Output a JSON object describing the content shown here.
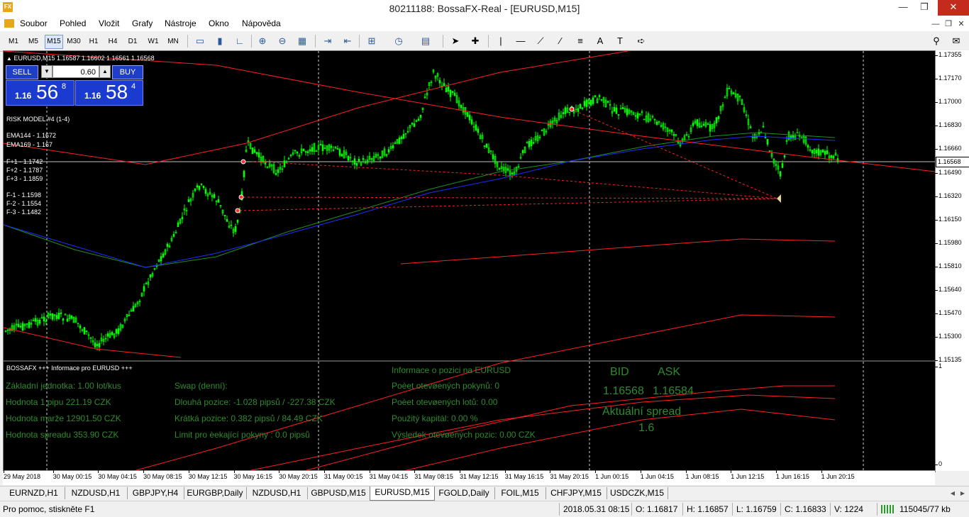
{
  "window": {
    "title": "80211188: BossaFX-Real - [EURUSD,M15]",
    "app_icon_text": "FX"
  },
  "menu": [
    "Soubor",
    "Pohled",
    "Vložit",
    "Grafy",
    "Nástroje",
    "Okno",
    "Nápověda"
  ],
  "toolbar": {
    "timeframes": [
      "M1",
      "M5",
      "M15",
      "M30",
      "H1",
      "H4",
      "D1",
      "W1",
      "MN"
    ],
    "active_timeframe": "M15"
  },
  "chart": {
    "header": "EURUSD,M15  1.16587 1.16602 1.16561 1.16568",
    "current_price": "1.16568",
    "price_ticks": [
      "1.17355",
      "1.17170",
      "1.17000",
      "1.16830",
      "1.16660",
      "1.16490",
      "1.16320",
      "1.16150",
      "1.15980",
      "1.15810",
      "1.15640",
      "1.15470",
      "1.15300",
      "1.15135"
    ],
    "time_ticks": [
      "29 May 2018",
      "30 May 00:15",
      "30 May 04:15",
      "30 May 08:15",
      "30 May 12:15",
      "30 May 16:15",
      "30 May 20:15",
      "31 May 00:15",
      "31 May 04:15",
      "31 May 08:15",
      "31 May 12:15",
      "31 May 16:15",
      "31 May 20:15",
      "1 Jun 00:15",
      "1 Jun 04:15",
      "1 Jun 08:15",
      "1 Jun 12:15",
      "1 Jun 16:15",
      "1 Jun 20:15"
    ],
    "indicator_scale_top": "1",
    "indicator_scale_bottom": "0",
    "risk_model": "RISK MODEL #4 (1-4)",
    "ema_labels": [
      "EMA144 - 1.1672",
      "EMA169 - 1.167"
    ],
    "fib_plus": [
      "F+1 - 1.1742",
      "F+2 - 1.1787",
      "F+3 - 1.1859"
    ],
    "fib_minus": [
      "F-1 - 1.1598",
      "F-2 - 1.1554",
      "F-3 - 1.1482"
    ],
    "colors": {
      "candles": "#00ff00",
      "ema144": "#1e2eff",
      "ema169": "#1f8f1f",
      "bands": "#ff2020",
      "background": "#000000"
    }
  },
  "one_click": {
    "sell_label": "SELL",
    "buy_label": "BUY",
    "lot": "0.60",
    "bid_small": "1.16",
    "bid_big": "56",
    "bid_sup": "8",
    "ask_small": "1.16",
    "ask_big": "58",
    "ask_sup": "4"
  },
  "info_panel": {
    "header": "BOSSAFX +++ Informace pro EURUSD +++",
    "col1": [
      "Základní jednotka: 1.00  lot/kus",
      "Hodnota 1 pipu 221.19 CZK",
      "Hodnota marže 12901.50 CZK",
      "Hodnota spreadu 353.90 CZK"
    ],
    "col2": [
      "Swap (denní):",
      "Dlouhá pozice:   -1.028 pipsů /  -227.38 CZK",
      "Krátká pozice:  0.382 pipsů /  84.49 CZK",
      "Limit pro èekající pokyny : 0.0  pipsů"
    ],
    "col3": [
      "Informace o pozici na EURUSD",
      "Poèet otevøených pokynů: 0",
      "Poèet otevøených lotů: 0.00",
      "Použitý kapitál: 0.00 %",
      "Výsledek otevøených pozic: 0.00 CZK"
    ],
    "bid_label": "BID",
    "ask_label": "ASK",
    "bid_value": "1.16568",
    "ask_value": "1.16584",
    "spread_label": "Aktuální spread",
    "spread_value": "1.6"
  },
  "tabs": [
    "EURNZD,H1",
    "NZDUSD,H1",
    "GBPJPY,H4",
    "EURGBP,Daily",
    "NZDUSD,H1",
    "GBPUSD,M15",
    "EURUSD,M15",
    "FGOLD,Daily",
    "FOIL,M15",
    "CHFJPY,M15",
    "USDCZK,M15"
  ],
  "active_tab": "EURUSD,M15",
  "status": {
    "help": "Pro pomoc, stiskněte F1",
    "datetime": "2018.05.31 08:15",
    "open": "O: 1.16817",
    "high": "H: 1.16857",
    "low": "L: 1.16759",
    "close": "C: 1.16833",
    "volume": "V: 1224",
    "traffic": "115045/77 kb"
  }
}
